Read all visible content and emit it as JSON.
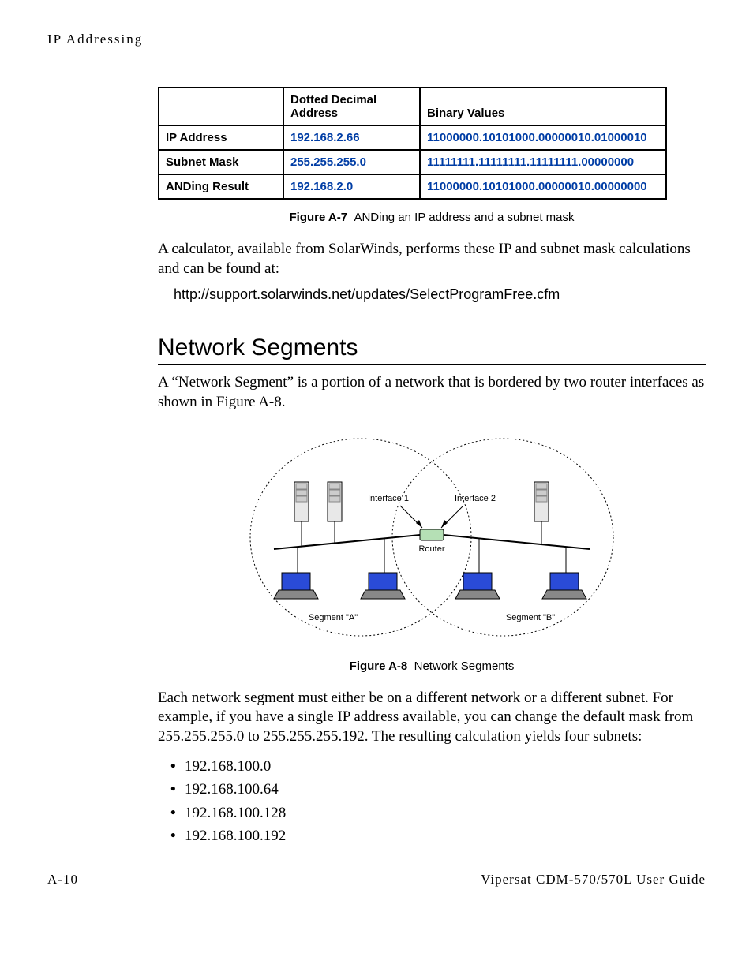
{
  "header": {
    "running": "IP Addressing"
  },
  "table": {
    "col_blank": "",
    "col_dotted": "Dotted Decimal Address",
    "col_binary": "Binary Values",
    "rows": [
      {
        "label": "IP Address",
        "dotted": "192.168.2.66",
        "binary": "11000000.10101000.00000010.01000010"
      },
      {
        "label": "Subnet Mask",
        "dotted": "255.255.255.0",
        "binary": "11111111.11111111.11111111.00000000"
      },
      {
        "label": "ANDing Result",
        "dotted": "192.168.2.0",
        "binary": "11000000.10101000.00000010.00000000"
      }
    ]
  },
  "captions": {
    "fig_a7_label": "Figure A-7",
    "fig_a7_text": "ANDing an IP address and a subnet mask",
    "fig_a8_label": "Figure A-8",
    "fig_a8_text": "Network Segments"
  },
  "paras": {
    "p1": "A calculator, available from SolarWinds, performs these IP and subnet mask calculations and can be found at:",
    "url": "http://support.solarwinds.net/updates/SelectProgramFree.cfm",
    "p2": "A “Network Segment” is a portion of a network that is bordered by two router interfaces as shown in Figure A-8.",
    "p3": "Each network segment must either be on a different network or a different subnet. For example, if you have a single IP address available, you can change the default mask from 255.255.255.0 to 255.255.255.192. The resulting calculation yields four subnets:"
  },
  "section_title": "Network Segments",
  "diagram": {
    "interface1": "Interface 1",
    "interface2": "Interface 2",
    "router": "Router",
    "segA": "Segment \"A\"",
    "segB": "Segment \"B\""
  },
  "subnets": [
    "192.168.100.0",
    "192.168.100.64",
    "192.168.100.128",
    "192.168.100.192"
  ],
  "footer": {
    "page": "A-10",
    "guide": "Vipersat CDM-570/570L User Guide"
  }
}
